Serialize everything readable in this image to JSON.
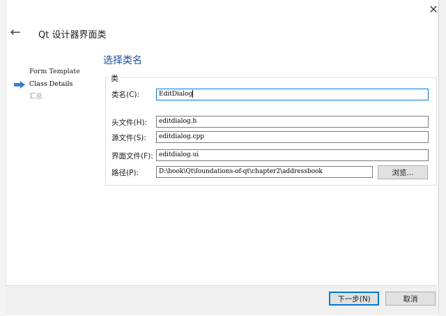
{
  "window": {
    "title": "Qt 设计器界面类",
    "close_glyph": "✕",
    "back_glyph": "←"
  },
  "steps": [
    {
      "label": "Form Template",
      "state": "done"
    },
    {
      "label": "Class Details",
      "state": "current"
    },
    {
      "label": "汇总",
      "state": "pending"
    }
  ],
  "section_title": "选择类名",
  "group": {
    "label": "类",
    "class_name": {
      "label": "类名(C):",
      "value": "EditDialog"
    },
    "header_file": {
      "label": "头文件(H):",
      "value": "editdialog.h"
    },
    "source_file": {
      "label": "源文件(S):",
      "value": "editdialog.cpp"
    },
    "form_file": {
      "label": "界面文件(F):",
      "value": "editdialog.ui"
    },
    "path": {
      "label": "路径(P):",
      "value": "D:\\book\\Qt\\foundations-of-qt\\chapter2\\addressbook"
    },
    "browse_label": "浏览..."
  },
  "footer": {
    "next_label": "下一步(N)",
    "cancel_label": "取消"
  },
  "colors": {
    "accent": "#1f4e9c",
    "step_arrow": "#3b7fd4",
    "focus_border": "#0078d7"
  }
}
